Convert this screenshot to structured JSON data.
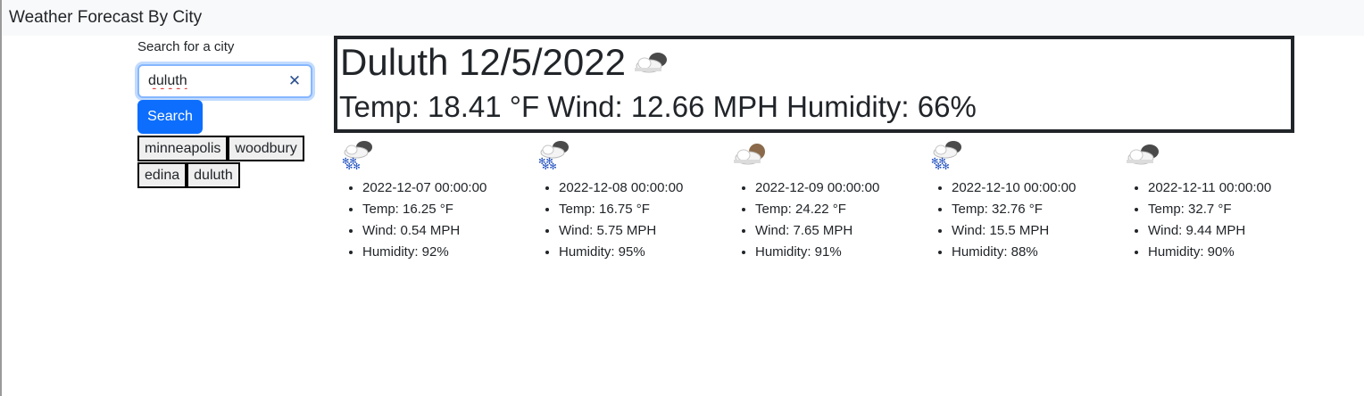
{
  "navbar": {
    "brand": "Weather Forecast By City"
  },
  "search": {
    "label": "Search for a city",
    "value": "duluth",
    "clear_icon": "close-icon",
    "button_label": "Search",
    "history": [
      "minneapolis",
      "woodbury",
      "edina",
      "duluth"
    ]
  },
  "current": {
    "city_date": "Duluth 12/5/2022",
    "icon": "cloudy-icon",
    "stats": "Temp: 18.41 °F Wind: 12.66 MPH Humidity: 66%"
  },
  "forecast": [
    {
      "icon": "snow-icon",
      "date": "2022-12-07 00:00:00",
      "temp": "Temp: 16.25 °F",
      "wind": "Wind: 0.54 MPH",
      "humidity": "Humidity: 92%"
    },
    {
      "icon": "snow-icon",
      "date": "2022-12-08 00:00:00",
      "temp": "Temp: 16.75 °F",
      "wind": "Wind: 5.75 MPH",
      "humidity": "Humidity: 95%"
    },
    {
      "icon": "partly-cloudy-night-icon",
      "date": "2022-12-09 00:00:00",
      "temp": "Temp: 24.22 °F",
      "wind": "Wind: 7.65 MPH",
      "humidity": "Humidity: 91%"
    },
    {
      "icon": "snow-icon",
      "date": "2022-12-10 00:00:00",
      "temp": "Temp: 32.76 °F",
      "wind": "Wind: 15.5 MPH",
      "humidity": "Humidity: 88%"
    },
    {
      "icon": "cloudy-icon",
      "date": "2022-12-11 00:00:00",
      "temp": "Temp: 32.7 °F",
      "wind": "Wind: 9.44 MPH",
      "humidity": "Humidity: 90%"
    }
  ]
}
